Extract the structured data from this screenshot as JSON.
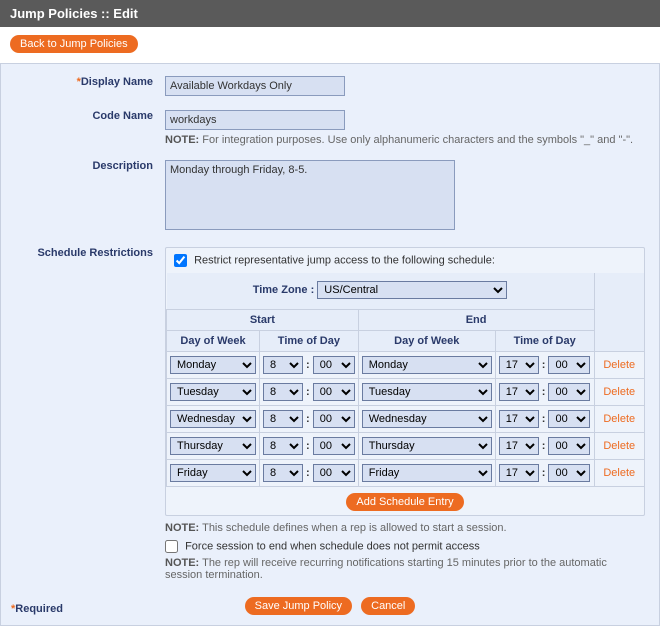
{
  "header": {
    "title": "Jump Policies :: Edit"
  },
  "backBtn": "Back to Jump Policies",
  "labels": {
    "displayName": "Display Name",
    "codeName": "Code Name",
    "description": "Description",
    "schedRestrictions": "Schedule Restrictions",
    "timeZone": "Time Zone :",
    "start": "Start",
    "end": "End",
    "dayOfWeek": "Day of Week",
    "timeOfDay": "Time of Day"
  },
  "fields": {
    "displayName": "Available Workdays Only",
    "codeName": "workdays",
    "description": "Monday through Friday, 8-5.",
    "restrictChecked": true,
    "restrictLabel": "Restrict representative jump access to the following schedule:",
    "timeZone": "US/Central",
    "forceEndChecked": false,
    "forceEndLabel": "Force session to end when schedule does not permit access"
  },
  "notes": {
    "codeName": "For integration purposes. Use only alphanumeric characters and the symbols \"_\" and \"-\".",
    "schedule": "This schedule defines when a rep is allowed to start a session.",
    "forceEnd": "The rep will receive recurring notifications starting 15 minutes prior to the automatic session termination.",
    "notePrefix": "NOTE:"
  },
  "schedule": [
    {
      "startDay": "Monday",
      "startHr": "8",
      "startMin": "00",
      "endDay": "Monday",
      "endHr": "17",
      "endMin": "00"
    },
    {
      "startDay": "Tuesday",
      "startHr": "8",
      "startMin": "00",
      "endDay": "Tuesday",
      "endHr": "17",
      "endMin": "00"
    },
    {
      "startDay": "Wednesday",
      "startHr": "8",
      "startMin": "00",
      "endDay": "Wednesday",
      "endHr": "17",
      "endMin": "00"
    },
    {
      "startDay": "Thursday",
      "startHr": "8",
      "startMin": "00",
      "endDay": "Thursday",
      "endHr": "17",
      "endMin": "00"
    },
    {
      "startDay": "Friday",
      "startHr": "8",
      "startMin": "00",
      "endDay": "Friday",
      "endHr": "17",
      "endMin": "00"
    }
  ],
  "actions": {
    "delete": "Delete",
    "addEntry": "Add Schedule Entry",
    "save": "Save Jump Policy",
    "cancel": "Cancel"
  },
  "requiredLabel": "Required"
}
